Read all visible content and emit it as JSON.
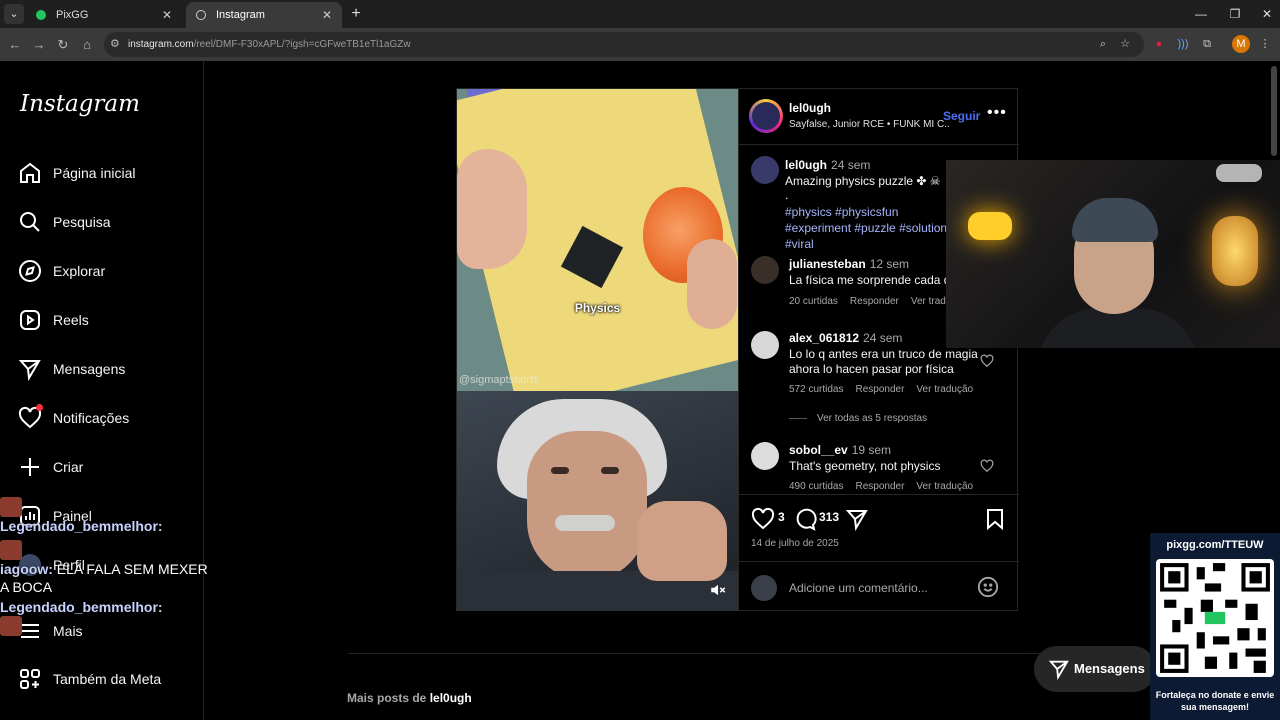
{
  "browser": {
    "tabs": [
      {
        "title": "PixGG",
        "active": false
      },
      {
        "title": "Instagram",
        "active": true
      }
    ],
    "url_domain": "instagram.com",
    "url_path": "/reel/DMF-F30xAPL/?igsh=cGFweTB1eTl1aGZw",
    "profile_initial": "M"
  },
  "instagram": {
    "logo": "Instagram",
    "nav": [
      {
        "label": "Página inicial",
        "icon": "home-icon"
      },
      {
        "label": "Pesquisa",
        "icon": "search-icon"
      },
      {
        "label": "Explorar",
        "icon": "compass-icon"
      },
      {
        "label": "Reels",
        "icon": "reels-icon"
      },
      {
        "label": "Mensagens",
        "icon": "send-icon"
      },
      {
        "label": "Notificações",
        "icon": "heart-icon"
      },
      {
        "label": "Criar",
        "icon": "plus-icon"
      },
      {
        "label": "Painel",
        "icon": "dashboard-icon"
      },
      {
        "label": "Perfil",
        "icon": "profile-icon"
      },
      {
        "label": "Mais",
        "icon": "menu-icon"
      },
      {
        "label": "Também da Meta",
        "icon": "meta-icon"
      }
    ],
    "post": {
      "video_label": "Physics",
      "watermark": "@sigmaptshorts",
      "username": "lel0ugh",
      "audio": "Sayfalse, Junior RCE • FUNK MI C...",
      "follow_label": "Seguir",
      "more_label": "•••",
      "caption": {
        "user": "lel0ugh",
        "time": "24 sem",
        "text": "Amazing physics puzzle ✤ ☠",
        "dot": ".",
        "tags": "#physics #physicsfun #experiment #puzzle #solution #viral"
      },
      "comments": [
        {
          "user": "julianesteban",
          "time": "12 sem",
          "text": "La física me sorprende cada día",
          "likes": "20 curtidas",
          "reply": "Responder",
          "translate": "Ver tradução"
        },
        {
          "user": "alex_061812",
          "time": "24 sem",
          "text": "Lo lo q antes era un truco de magia ahora lo hacen pasar por física",
          "likes": "572 curtidas",
          "reply": "Responder",
          "translate": "Ver tradução"
        },
        {
          "user": "sobol__ev",
          "time": "19 sem",
          "text": "That's geometry, not physics",
          "likes": "490 curtidas",
          "reply": "Responder",
          "translate": "Ver tradução"
        }
      ],
      "view_replies": "Ver todas as 5 respostas",
      "like_count": "3",
      "comment_count": "313",
      "date": "14 de julho de 2025",
      "comment_placeholder": "Adicione um comentário..."
    },
    "more_posts_prefix": "Mais posts de",
    "more_posts_user": "lel0ugh",
    "messages_button": "Mensagens"
  },
  "chat": [
    {
      "name": "Legendado_bemmelhor:",
      "message": ""
    },
    {
      "name": "iagoow:",
      "message": "ELA FALA SEM MEXER A BOCA"
    },
    {
      "name": "Legendado_bemmelhor:",
      "message": ""
    }
  ],
  "donation": {
    "url": "pixgg.com/TTEUW",
    "caption": "Fortaleça no donate e envie sua mensagem!"
  },
  "colors": {
    "accent": "#4c6ef5",
    "hashtag": "#a5b4fc",
    "notification": "#ff3040"
  }
}
